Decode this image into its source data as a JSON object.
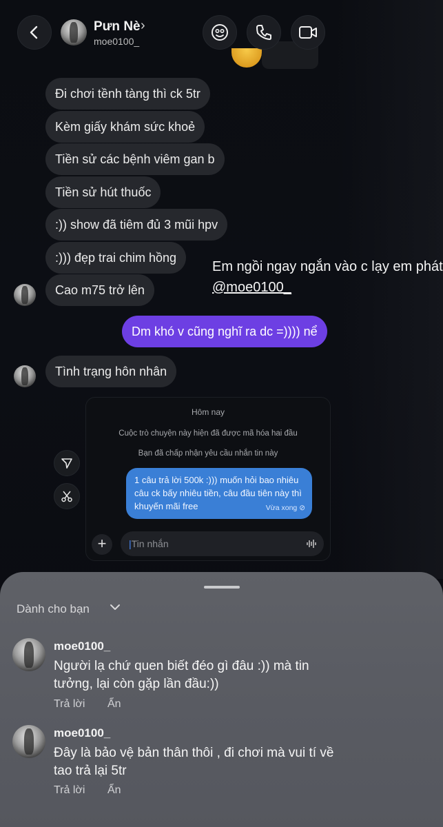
{
  "header": {
    "contact_name": "Pưn Nè",
    "chevron": "›",
    "username": "moe0100_",
    "icons": [
      "back-chevron-icon",
      "sticker-icon",
      "phone-icon",
      "video-camera-icon"
    ]
  },
  "messages": [
    {
      "text": "Đi chơi tềnh tàng thì ck 5tr"
    },
    {
      "text": "Kèm giấy khám sức khoẻ"
    },
    {
      "text": "Tiền sử các bệnh viêm gan b"
    },
    {
      "text": "Tiền sử hút thuốc"
    },
    {
      "text": ":)) show đã tiêm đủ 3 mũi hpv"
    },
    {
      "text": ":))) đẹp trai chim hồng"
    },
    {
      "text": "Cao m75 trở lên"
    }
  ],
  "outgoing_message": "Dm khó v cũng nghĩ ra dc =)))) nể",
  "message_after": "Tình trạng hôn nhân",
  "overlay": {
    "line1": "Em ngồi ngay ngắn vào c lạy em phát",
    "mention": "@moe0100_"
  },
  "inner_screenshot": {
    "date_label": "Hôm nay",
    "encrypted_notice": "Cuộc trò chuyện này hiện đã được mã hóa hai đầu",
    "accepted_notice": "Bạn đã chấp nhận yêu cầu nhắn tin này",
    "bubble_text": "1 câu trả lời 500k :))) muốn hỏi bao nhiêu câu ck bấy nhiêu tiền, câu đầu tiên này thì khuyến mãi free",
    "seen_label": "Vừa xong",
    "input_placeholder": "Tin nhắn",
    "plus": "+"
  },
  "sheet": {
    "section_title": "Dành cho bạn",
    "comments": [
      {
        "username": "moe0100_",
        "text_line1": "Người lạ chứ quen biết đéo gì đâu :)) mà tin",
        "text_line2": "tưởng, lại còn gặp lần đầu:))",
        "reply": "Trả lời",
        "hide": "Ẩn"
      },
      {
        "username": "moe0100_",
        "text_line1": "Đây là bảo vệ bản thân thôi , đi chơi mà vui tí về",
        "text_line2": "tao trả lại 5tr",
        "reply": "Trả lời",
        "hide": "Ẩn"
      }
    ]
  },
  "colors": {
    "outgoing_bubble": "#6d3fe3",
    "incoming_bubble": "#26282d",
    "inner_bubble": "#3a7fd6",
    "sheet_bg": "#5c5e65"
  }
}
